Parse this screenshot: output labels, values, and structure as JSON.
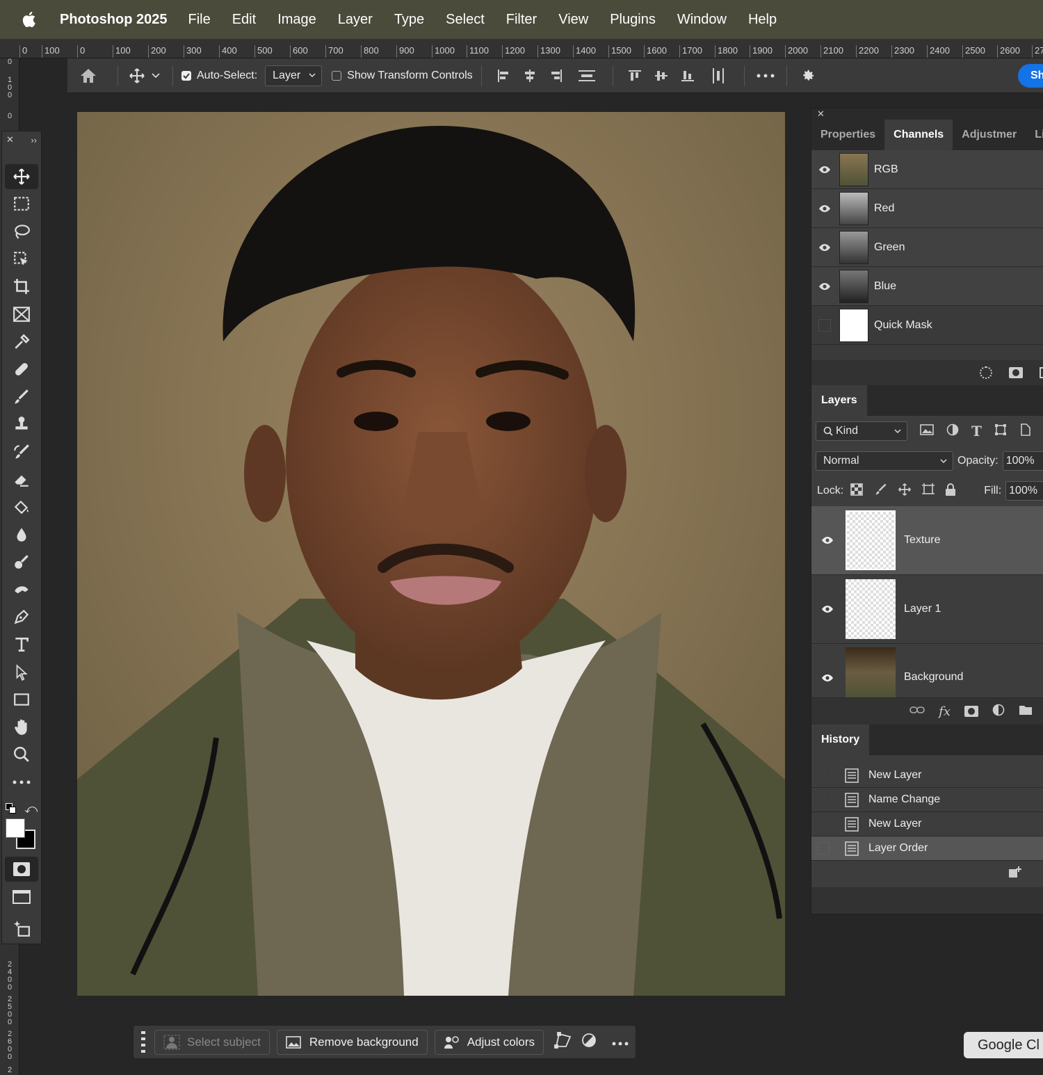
{
  "menubar": {
    "app_name": "Photoshop 2025",
    "items": [
      "File",
      "Edit",
      "Image",
      "Layer",
      "Type",
      "Select",
      "Filter",
      "View",
      "Plugins",
      "Window",
      "Help"
    ]
  },
  "rulers": {
    "horizontal": [
      "0",
      "100",
      "0",
      "100",
      "200",
      "300",
      "400",
      "500",
      "600",
      "700",
      "800",
      "900",
      "1000",
      "1100",
      "1200",
      "1300",
      "1400",
      "1500",
      "1600",
      "1700",
      "1800",
      "1900",
      "2000",
      "2100",
      "2200",
      "2300",
      "2400",
      "2500",
      "2600",
      "27"
    ],
    "vertical_top": [
      "0",
      "100",
      "0"
    ],
    "vertical_bottom": [
      "2400",
      "2500",
      "2600",
      "2"
    ]
  },
  "options_bar": {
    "auto_select_label": "Auto-Select:",
    "auto_select_value": "Layer",
    "show_transform_label": "Show Transform Controls",
    "share_label": "Sh"
  },
  "channels_panel": {
    "tabs": [
      "Properties",
      "Channels",
      "Adjustmer",
      "Libr"
    ],
    "active_tab": "Channels",
    "channels": [
      {
        "name": "RGB",
        "visible": true
      },
      {
        "name": "Red",
        "visible": true
      },
      {
        "name": "Green",
        "visible": true
      },
      {
        "name": "Blue",
        "visible": true
      },
      {
        "name": "Quick Mask",
        "visible": false
      }
    ]
  },
  "layers_panel": {
    "title": "Layers",
    "filter_kind": "Kind",
    "blend_mode": "Normal",
    "opacity_label": "Opacity:",
    "opacity_value": "100%",
    "lock_label": "Lock:",
    "fill_label": "Fill:",
    "fill_value": "100%",
    "layers": [
      {
        "name": "Texture",
        "selected": true
      },
      {
        "name": "Layer 1",
        "selected": false
      },
      {
        "name": "Background",
        "selected": false
      }
    ]
  },
  "history_panel": {
    "title": "History",
    "items": [
      "New Layer",
      "Name Change",
      "New Layer",
      "Layer Order"
    ],
    "active_index": 3
  },
  "contextual_taskbar": {
    "select_subject": "Select subject",
    "remove_background": "Remove background",
    "adjust_colors": "Adjust colors"
  },
  "google_tooltip": "Google Cl",
  "colors": {
    "menubar_bg": "#4b4b3c",
    "panel_bg": "#323232",
    "accent": "#1473e6"
  }
}
